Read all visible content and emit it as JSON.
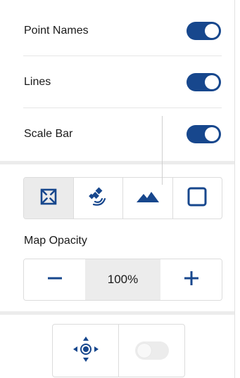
{
  "toggles": [
    {
      "label": "Point Names",
      "on": true
    },
    {
      "label": "Lines",
      "on": true
    },
    {
      "label": "Scale Bar",
      "on": true
    }
  ],
  "map_style": {
    "buttons": [
      {
        "icon": "map-frame-icon",
        "active": true
      },
      {
        "icon": "satellite-icon",
        "active": false
      },
      {
        "icon": "terrain-icon",
        "active": false
      },
      {
        "icon": "blank-square-icon",
        "active": false
      }
    ]
  },
  "opacity": {
    "title": "Map Opacity",
    "value": "100%",
    "minus_icon": "minus-icon",
    "plus_icon": "plus-icon"
  },
  "bottom": {
    "locate_icon": "locate-icon",
    "toggle_on": false
  },
  "colors": {
    "accent": "#17478d",
    "active_bg": "#ebebeb",
    "divider": "#ececec"
  }
}
